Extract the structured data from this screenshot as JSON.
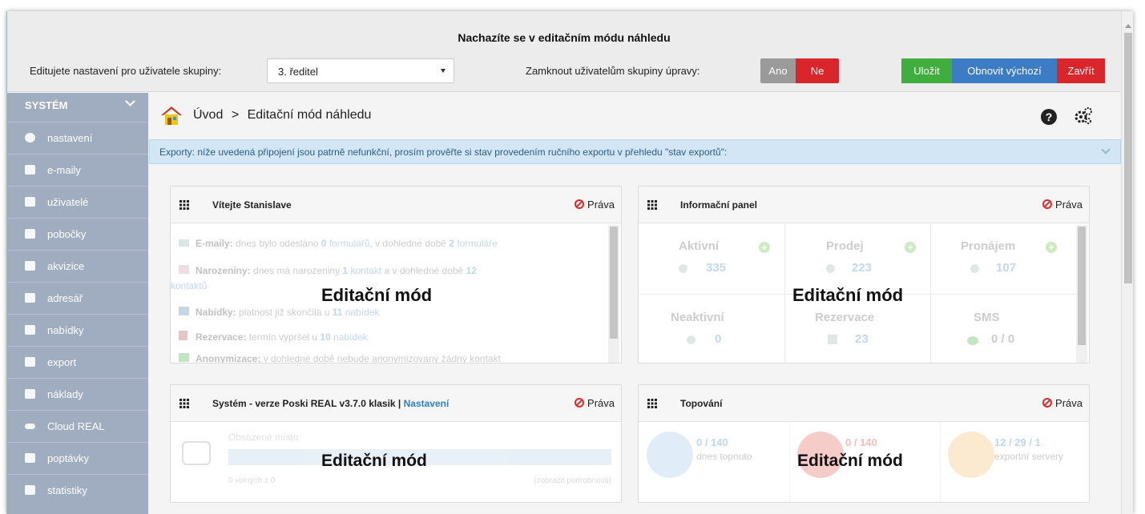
{
  "topbar": {
    "title": "Nachazíte se v editačním módu náhledu",
    "group_label": "Editujete nastavení pro uživatele skupiny:",
    "group_select_value": "3. ředitel",
    "lock_label": "Zamknout uživatelům skupiny úpravy:",
    "lock_yes": "Ano",
    "lock_no": "Ne",
    "save": "Uložit",
    "restore": "Obnovit výchozí",
    "close": "Zavřít"
  },
  "sidebar": {
    "heading": "SYSTÉM",
    "items": [
      {
        "label": "nastavení",
        "icon": "gear-icon"
      },
      {
        "label": "e-maily",
        "icon": "mail-icon"
      },
      {
        "label": "uživatelé",
        "icon": "users-icon"
      },
      {
        "label": "pobočky",
        "icon": "branch-icon"
      },
      {
        "label": "akvizice",
        "icon": "acquisition-icon"
      },
      {
        "label": "adresář",
        "icon": "address-book-icon"
      },
      {
        "label": "nabídky",
        "icon": "offers-icon"
      },
      {
        "label": "export",
        "icon": "export-icon"
      },
      {
        "label": "náklady",
        "icon": "costs-icon"
      },
      {
        "label": "Cloud REAL",
        "icon": "cloud-icon"
      },
      {
        "label": "poptávky",
        "icon": "demand-icon"
      },
      {
        "label": "statistiky",
        "icon": "stats-icon"
      }
    ]
  },
  "breadcrumb": {
    "home": "Úvod",
    "separator": ">",
    "current": "Editační mód náhledu"
  },
  "alert": "Exporty: níže uvedená připojení jsou patrně nefunkční, prosím prověřte si stav provedením ručního exportu v přehledu \"stav exportů\":",
  "overlay_text": "Editační mód",
  "prava": "Práva",
  "panels": {
    "welcome": {
      "title": "Vítejte Stanislave",
      "lines": [
        {
          "label": "E-maily:",
          "text1": " dnes bylo odesláno ",
          "n1": "0",
          "l1": " formulářů",
          "text2": ", v dohledné době ",
          "n2": "2",
          "l2": " formuláře"
        },
        {
          "label": "Narozeniny:",
          "text1": " dnes má narozeniny ",
          "n1": "1",
          "l1": " kontakt",
          "text2": " a v dohledné době ",
          "n2": "12",
          "l2": "kontaktů"
        },
        {
          "label": "Nabídky:",
          "text1": " platnost již skončila u ",
          "n1": "11",
          "l1": " nabídek"
        },
        {
          "label": "Rezervace:",
          "text1": " termín vypršel u ",
          "n1": "10",
          "l1": " nabídek"
        },
        {
          "label": "Anonymizace:",
          "text1": " v dohledné době nebude anonymizovaný žádný kontakt"
        }
      ]
    },
    "info": {
      "title": "Informační panel",
      "cells": [
        {
          "label": "Aktivní",
          "value": "335"
        },
        {
          "label": "Prodej",
          "value": "223"
        },
        {
          "label": "Pronájem",
          "value": "107"
        },
        {
          "label": "Neaktivní",
          "value": "0"
        },
        {
          "label": "Rezervace",
          "value": "23"
        },
        {
          "label": "SMS",
          "value": "0 / 0"
        }
      ]
    },
    "system": {
      "title": "Systém - verze Poski REAL v3.7.0 klasik | ",
      "settings_link": "Nastavení",
      "space_label": "Obsazené místo",
      "free": "0 volných z 0",
      "details": "(zobrazit podrobnosti)"
    },
    "topovani": {
      "title": "Topování",
      "stats": [
        {
          "value": "0 / 140",
          "label": "dnes topnuto"
        },
        {
          "value": "0 / 140",
          "label": ""
        },
        {
          "value": "12 / 29 / 1",
          "label": "exportní servery"
        }
      ]
    }
  },
  "colors": {
    "sidebar": "#2e4a74",
    "green": "#3fae3f",
    "blue": "#3b7cc4",
    "red": "#d9262a"
  }
}
